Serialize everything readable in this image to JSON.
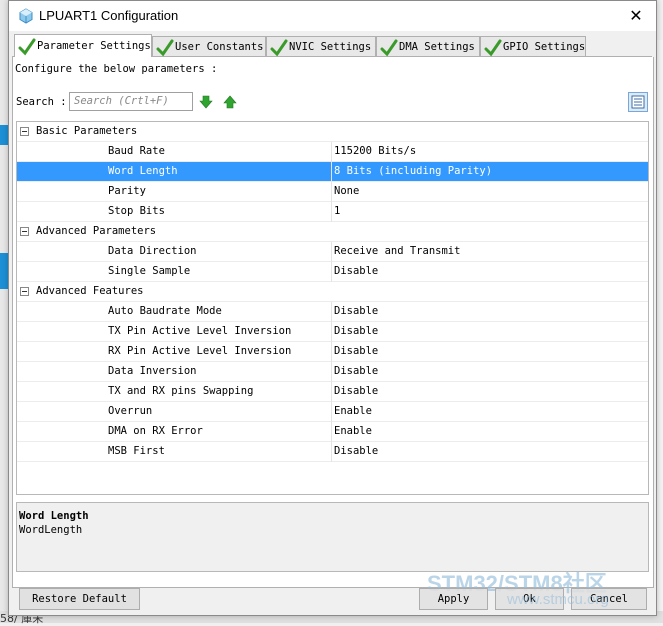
{
  "background": {
    "bottom_text": "58/ 庫未"
  },
  "window": {
    "title": "LPUART1 Configuration",
    "close_glyph": "✕"
  },
  "tabs": [
    {
      "label": "Parameter Settings",
      "active": true
    },
    {
      "label": "User Constants",
      "active": false
    },
    {
      "label": "NVIC Settings",
      "active": false
    },
    {
      "label": "DMA Settings",
      "active": false
    },
    {
      "label": "GPIO Settings",
      "active": false
    }
  ],
  "content": {
    "instruction": "Configure the below parameters :",
    "search": {
      "label": "Search :",
      "placeholder": "Search (Crtl+F)"
    },
    "icons": [
      "arrow-down-icon",
      "arrow-up-icon",
      "list-view-icon"
    ]
  },
  "groups": [
    {
      "label": "Basic Parameters",
      "params": [
        {
          "name": "Baud Rate",
          "value": "115200 Bits/s"
        },
        {
          "name": "Word Length",
          "value": "8 Bits (including Parity)",
          "selected": true
        },
        {
          "name": "Parity",
          "value": "None"
        },
        {
          "name": "Stop Bits",
          "value": "1"
        }
      ]
    },
    {
      "label": "Advanced Parameters",
      "params": [
        {
          "name": "Data Direction",
          "value": "Receive and Transmit"
        },
        {
          "name": "Single Sample",
          "value": "Disable"
        }
      ]
    },
    {
      "label": "Advanced Features",
      "params": [
        {
          "name": "Auto Baudrate Mode",
          "value": "Disable"
        },
        {
          "name": "TX Pin Active Level Inversion",
          "value": "Disable"
        },
        {
          "name": "RX Pin Active Level Inversion",
          "value": "Disable"
        },
        {
          "name": "Data Inversion",
          "value": "Disable"
        },
        {
          "name": "TX and RX pins Swapping",
          "value": "Disable"
        },
        {
          "name": "Overrun",
          "value": "Enable"
        },
        {
          "name": "DMA on RX Error",
          "value": "Enable"
        },
        {
          "name": "MSB First",
          "value": "Disable"
        }
      ]
    }
  ],
  "description": {
    "title": "Word Length",
    "text": "WordLength"
  },
  "buttons": {
    "restore": "Restore Default",
    "apply": "Apply",
    "ok": "Ok",
    "cancel": "Cancel"
  },
  "watermark": {
    "main": "STM32/STM8社区",
    "sub": "www.stmcu.org"
  },
  "colors": {
    "selection": "#3399ff",
    "check_green": "#3a9a2a",
    "arrow_green": "#2fa52f"
  }
}
